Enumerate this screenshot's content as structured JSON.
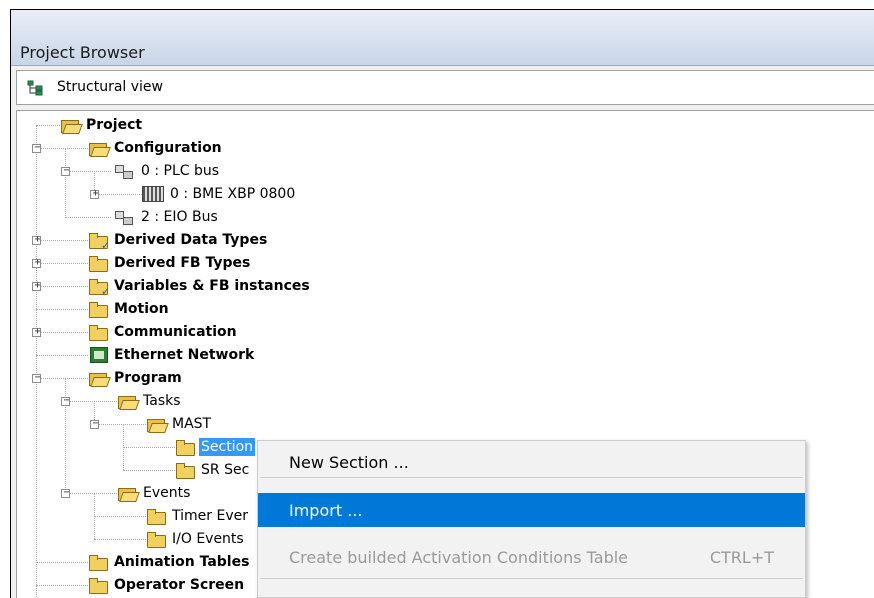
{
  "window": {
    "title": "Project Browser"
  },
  "toolbar": {
    "view_label": "Structural view",
    "view_icon": "structural-view-icon"
  },
  "tree": {
    "project": "Project",
    "configuration": "Configuration",
    "plc_bus": "0 : PLC bus",
    "bme_xbp": "0 : BME XBP 0800",
    "eio_bus": "2 : EIO Bus",
    "derived_data_types": "Derived Data Types",
    "derived_fb_types": "Derived FB Types",
    "variables": "Variables & FB instances",
    "motion": "Motion",
    "communication": "Communication",
    "ethernet_network": "Ethernet Network",
    "program": "Program",
    "tasks": "Tasks",
    "mast": "MAST",
    "sections": "Section",
    "sr_sections": "SR Sec",
    "events": "Events",
    "timer_events": "Timer Ever",
    "io_events": "I/O Events",
    "animation_tables": "Animation Tables",
    "operator_screens": "Operator Screen"
  },
  "context_menu": {
    "new_section": "New Section ...",
    "import": "Import ...",
    "create_table": "Create builded Activation Conditions Table",
    "create_table_shortcut": "CTRL+T"
  },
  "colors": {
    "selection": "#3399ff",
    "menu_highlight": "#0078d7",
    "folder": "#f2d060"
  }
}
